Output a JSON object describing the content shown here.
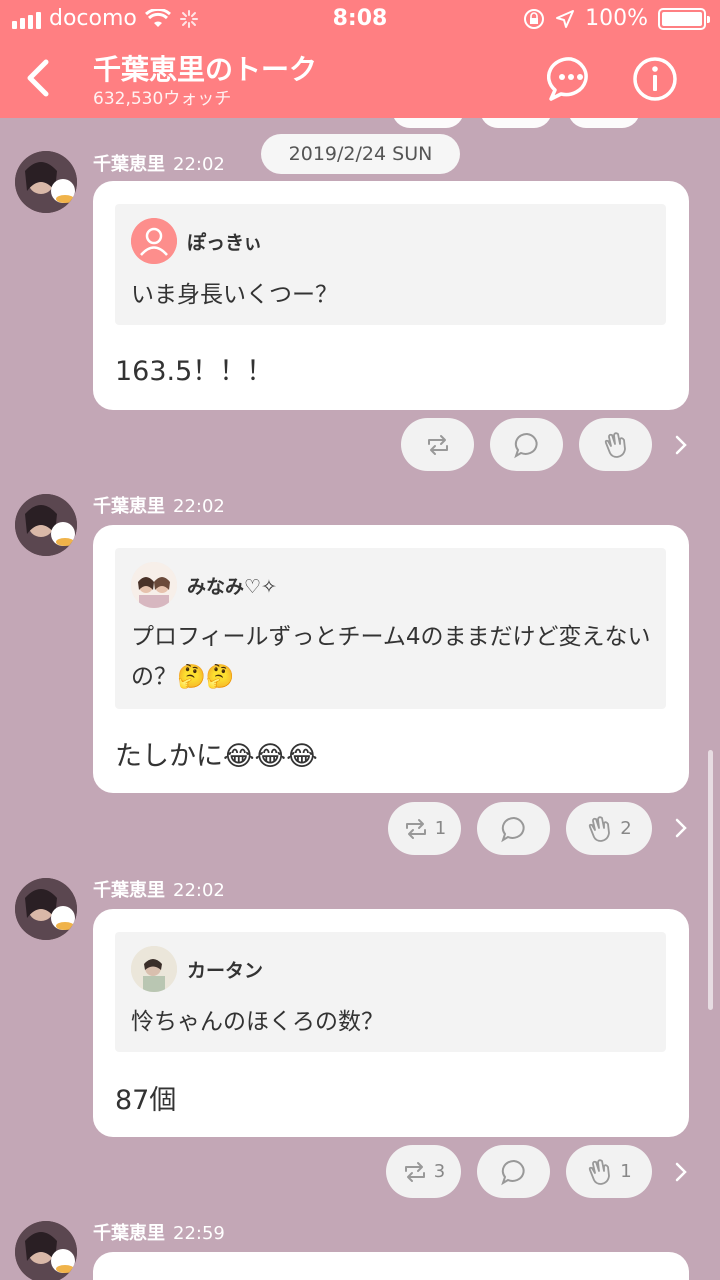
{
  "status_bar": {
    "carrier": "docomo",
    "time": "8:08",
    "battery": "100%"
  },
  "header": {
    "title": "千葉恵里のトーク",
    "subtitle": "632,530ウォッチ"
  },
  "date_pill": "2019/2/24 SUN",
  "posts": [
    {
      "author": "千葉恵里",
      "time": "22:02",
      "quote_author": "ぽっきぃ",
      "quote_text": "いま身長いくつー？",
      "answer": "163.5！！！",
      "repost_count": "",
      "clap_count": ""
    },
    {
      "author": "千葉恵里",
      "time": "22:02",
      "quote_author": "みなみ♡✧",
      "quote_text": "プロフィールずっとチーム4のままだけど変えないの？🤔🤔",
      "answer": "たしかに😂😂😂",
      "repost_count": "1",
      "clap_count": "2"
    },
    {
      "author": "千葉恵里",
      "time": "22:02",
      "quote_author": "カータン",
      "quote_text": "怜ちゃんのほくろの数？",
      "answer": "87個",
      "repost_count": "3",
      "clap_count": "1"
    },
    {
      "author": "千葉恵里",
      "time": "22:59"
    }
  ],
  "icons": {
    "back": "chevron-left-icon",
    "chat": "chat-bubble-icon",
    "info": "info-icon",
    "repost": "repost-icon",
    "comment": "comment-icon",
    "clap": "clap-icon"
  },
  "colors": {
    "header": "#ff7f82",
    "background": "#c3a7b6",
    "card": "#ffffff",
    "quote_bg": "#f3f3f3"
  }
}
